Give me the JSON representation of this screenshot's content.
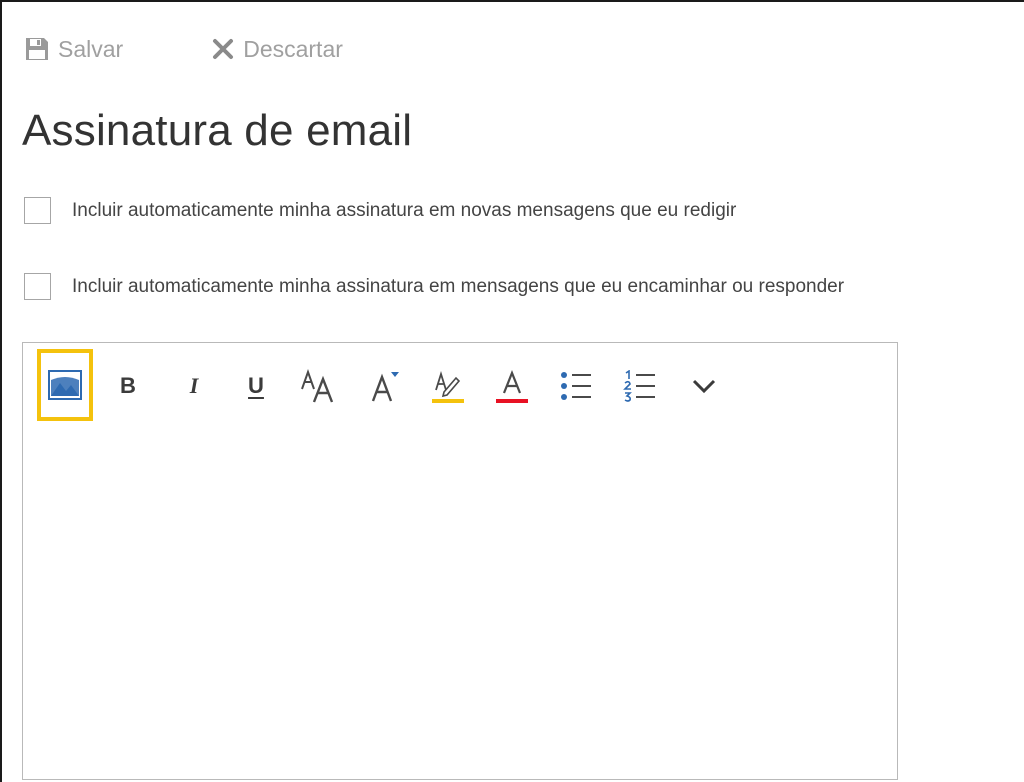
{
  "toolbar": {
    "save_label": "Salvar",
    "discard_label": "Descartar"
  },
  "page": {
    "title": "Assinatura de email"
  },
  "options": [
    {
      "label": "Incluir automaticamente minha assinatura em novas mensagens que eu redigir",
      "checked": false
    },
    {
      "label": "Incluir automaticamente minha assinatura em mensagens que eu encaminhar ou responder",
      "checked": false
    }
  ],
  "editor": {
    "format_bar": {
      "bold_glyph": "B",
      "italic_glyph": "I",
      "underline_glyph": "U",
      "icons": [
        "insert-image-icon",
        "bold-icon",
        "italic-icon",
        "underline-icon",
        "font-size-icon",
        "superscript-icon",
        "highlight-icon",
        "font-color-icon",
        "bulleted-list-icon",
        "numbered-list-icon",
        "chevron-down-icon"
      ]
    },
    "content": ""
  },
  "colors": {
    "accent_blue": "#2e6ab1",
    "highlight_yellow": "#f4c20d",
    "font_color_red": "#e81123",
    "command_gray": "#a0a0a0"
  }
}
